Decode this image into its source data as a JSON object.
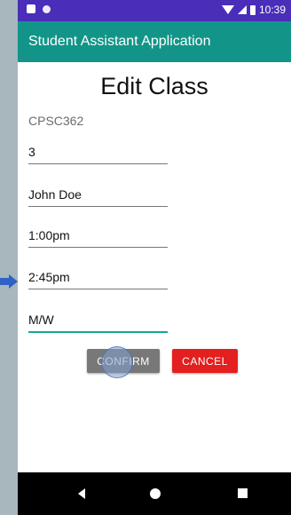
{
  "status": {
    "time": "10:39"
  },
  "app_bar": {
    "title": "Student Assistant Application"
  },
  "screen": {
    "title": "Edit Class",
    "course_code": "CPSC362",
    "fields": [
      "3",
      "John Doe",
      "1:00pm",
      "2:45pm",
      "M/W"
    ]
  },
  "buttons": {
    "confirm": "CONFIRM",
    "cancel": "CANCEL"
  },
  "nav": {
    "back_icon": "back-triangle",
    "home_icon": "home-circle",
    "recents_icon": "recents-square"
  },
  "colors": {
    "status_bar": "#4a2db8",
    "app_bar": "#129588",
    "cancel": "#e3201f",
    "active_underline": "#14a697"
  }
}
